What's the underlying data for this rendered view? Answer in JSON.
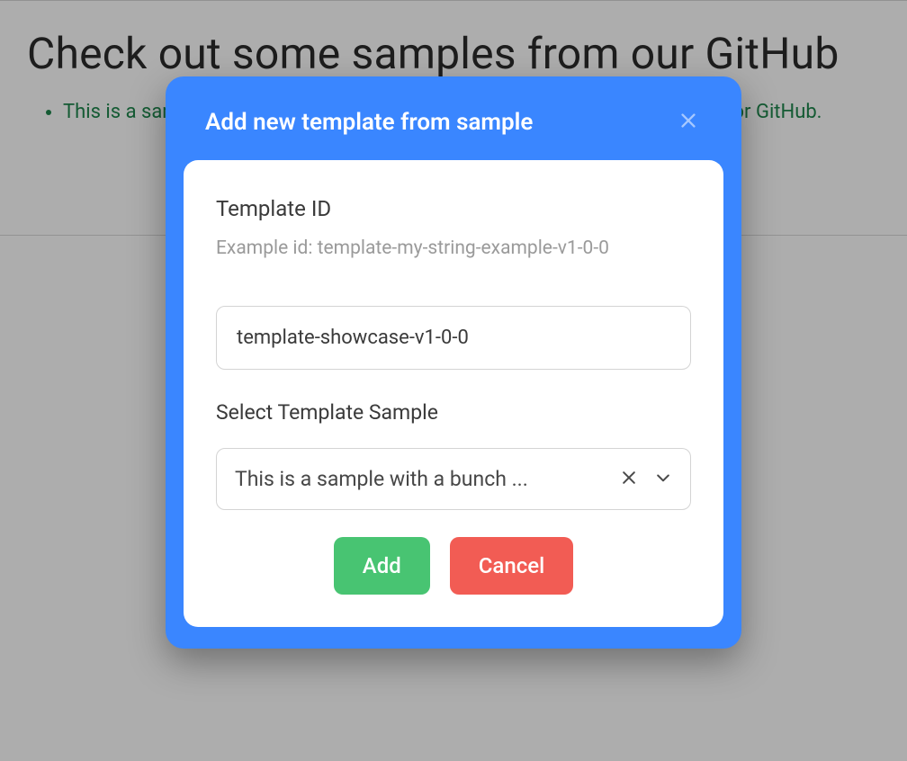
{
  "page": {
    "heading": "Check out some samples from our GitHub",
    "listItem": "This is a sample with a bunch of different elements to shwocase templates for GitHub."
  },
  "dialog": {
    "title": "Add new template from sample",
    "templateIdLabel": "Template ID",
    "templateIdHint": "Example id: template-my-string-example-v1-0-0",
    "templateIdValue": "template-showcase-v1-0-0",
    "selectLabel": "Select Template Sample",
    "selectValue": "This is a sample with a bunch ...",
    "addLabel": "Add",
    "cancelLabel": "Cancel"
  }
}
